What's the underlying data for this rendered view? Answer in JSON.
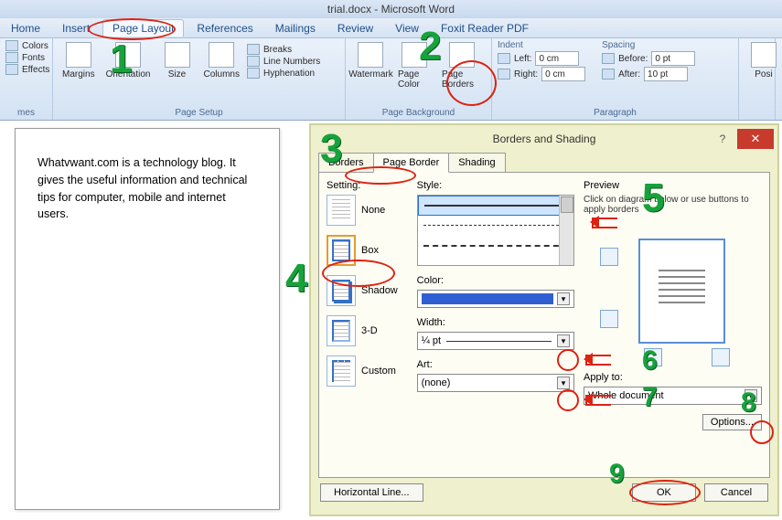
{
  "app": {
    "title": "trial.docx - Microsoft Word"
  },
  "tabs": [
    "Home",
    "Insert",
    "Page Layout",
    "References",
    "Mailings",
    "Review",
    "View",
    "Foxit Reader PDF"
  ],
  "ribbon": {
    "themes": {
      "colors": "Colors",
      "fonts": "Fonts",
      "effects": "Effects",
      "group": "mes"
    },
    "pageSetup": {
      "margins": "Margins",
      "orientation": "Orientation",
      "size": "Size",
      "columns": "Columns",
      "breaks": "Breaks",
      "lineNumbers": "Line Numbers",
      "hyphenation": "Hyphenation",
      "group": "Page Setup"
    },
    "pageBackground": {
      "watermark": "Watermark",
      "pageColor": "Page Color",
      "pageBorders": "Page Borders",
      "group": "Page Background"
    },
    "paragraph": {
      "indent": "Indent",
      "left": "Left:",
      "leftVal": "0 cm",
      "right": "Right:",
      "rightVal": "0 cm",
      "spacing": "Spacing",
      "before": "Before:",
      "beforeVal": "0 pt",
      "after": "After:",
      "afterVal": "10 pt",
      "group": "Paragraph"
    },
    "arrange": {
      "position": "Posi"
    }
  },
  "doc": {
    "text": "Whatvwant.com is a technology blog. It gives the useful information and technical tips for computer, mobile and internet users."
  },
  "dialog": {
    "title": "Borders and Shading",
    "tabs": {
      "borders": "Borders",
      "pageBorder": "Page Border",
      "shading": "Shading"
    },
    "settingLabel": "Setting:",
    "settings": {
      "none": "None",
      "box": "Box",
      "shadow": "Shadow",
      "threeD": "3-D",
      "custom": "Custom"
    },
    "styleLabel": "Style:",
    "colorLabel": "Color:",
    "widthLabel": "Width:",
    "widthVal": "¼ pt",
    "artLabel": "Art:",
    "artVal": "(none)",
    "previewLabel": "Preview",
    "previewHint": "Click on diagram below or use buttons to apply borders",
    "applyToLabel": "Apply to:",
    "applyToVal": "Whole document",
    "options": "Options...",
    "hLine": "Horizontal Line...",
    "ok": "OK",
    "cancel": "Cancel"
  }
}
